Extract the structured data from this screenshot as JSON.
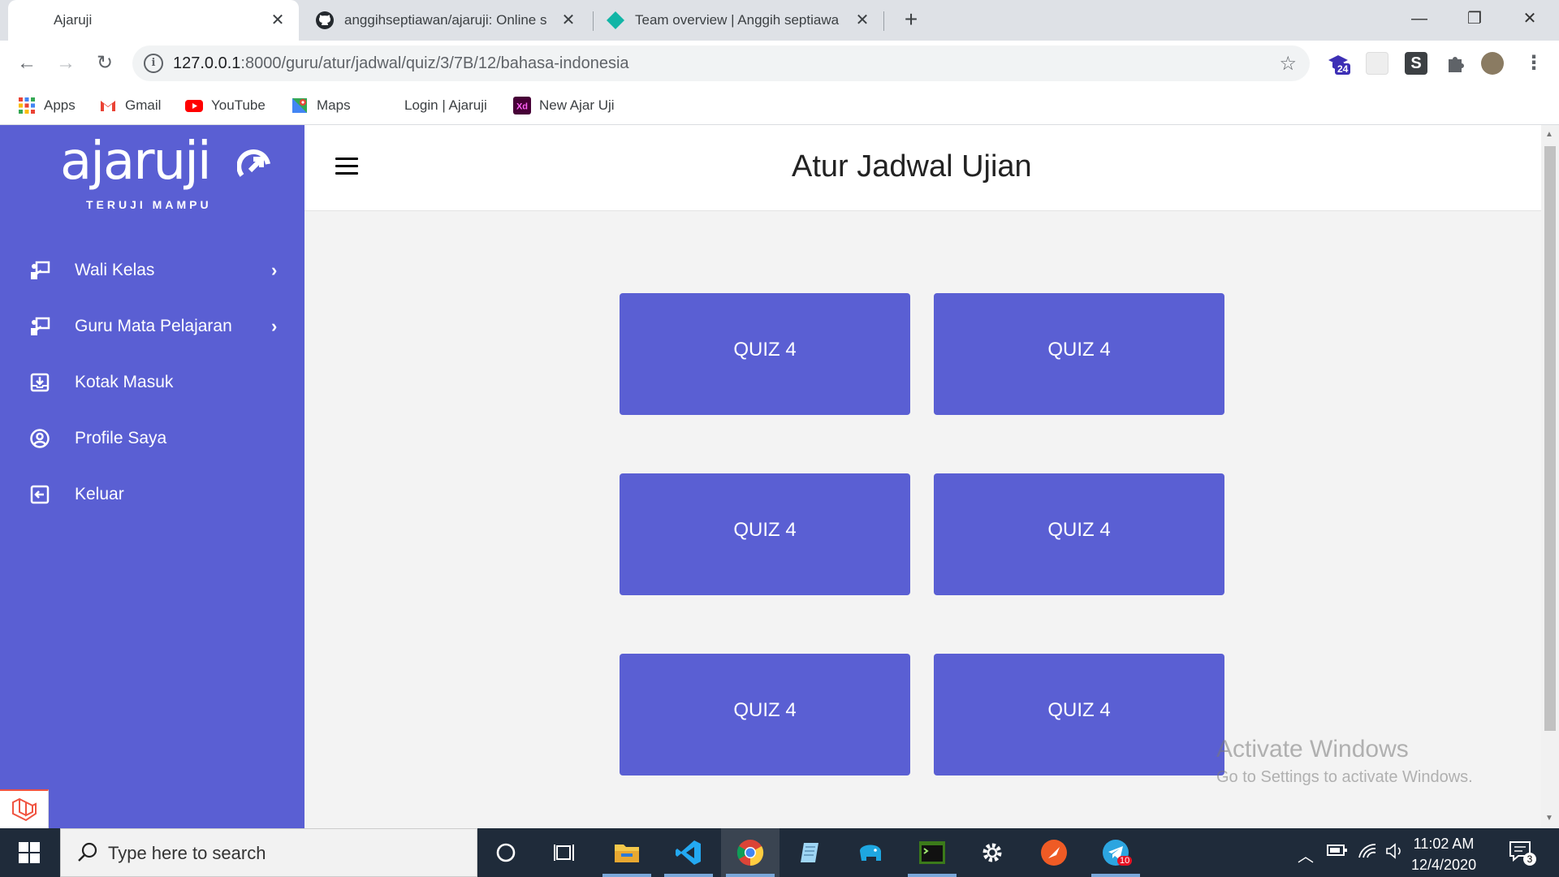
{
  "browser": {
    "tabs": [
      {
        "title": "Ajaruji",
        "active": true
      },
      {
        "title": "anggihseptiawan/ajaruji: Online s",
        "active": false
      },
      {
        "title": "Team overview | Anggih septiawa",
        "active": false
      }
    ],
    "new_tab_symbol": "+",
    "window_controls": {
      "minimize": "—",
      "restore": "❐",
      "close": "✕"
    },
    "url": {
      "host": "127.0.0.1",
      "path": ":8000/guru/atur/jadwal/quiz/3/7B/12/bahasa-indonesia"
    },
    "extension_badge": "24",
    "bookmarks": [
      "Apps",
      "Gmail",
      "YouTube",
      "Maps",
      "Login | Ajaruji",
      "New Ajar Uji"
    ]
  },
  "sidebar": {
    "logo_word": "ajaruji",
    "logo_tagline": "TERUJI MAMPU",
    "items": [
      {
        "label": "Wali Kelas",
        "icon": "chalkboard-teacher-icon",
        "has_submenu": true
      },
      {
        "label": "Guru Mata Pelajaran",
        "icon": "chalkboard-teacher-icon",
        "has_submenu": true
      },
      {
        "label": "Kotak Masuk",
        "icon": "inbox-icon",
        "has_submenu": false
      },
      {
        "label": "Profile Saya",
        "icon": "user-circle-icon",
        "has_submenu": false
      },
      {
        "label": "Keluar",
        "icon": "logout-icon",
        "has_submenu": false
      }
    ],
    "chevron": "›"
  },
  "header": {
    "title": "Atur Jadwal Ujian"
  },
  "quizzes": [
    "QUIZ 4",
    "QUIZ 4",
    "QUIZ 4",
    "QUIZ 4",
    "QUIZ 4",
    "QUIZ 4"
  ],
  "watermark": {
    "line1": "Activate Windows",
    "line2": "Go to Settings to activate Windows."
  },
  "taskbar": {
    "search_placeholder": "Type here to search",
    "time": "11:02 AM",
    "date": "12/4/2020",
    "telegram_badge": "10",
    "notification_count": "3"
  },
  "colors": {
    "accent": "#5a5fd3",
    "taskbar": "#1f2b3a"
  }
}
